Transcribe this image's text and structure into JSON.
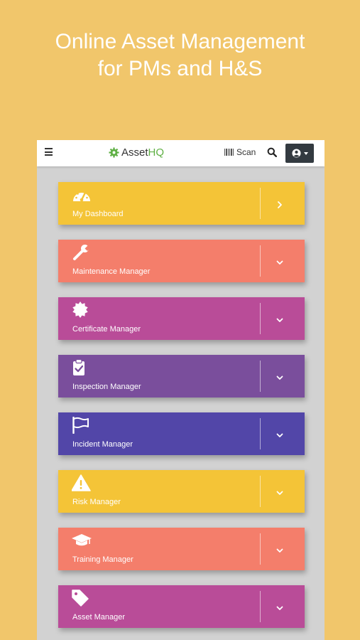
{
  "headline": {
    "line1": "Online Asset Management",
    "line2": "for PMs and H&S"
  },
  "topbar": {
    "logo_prefix": "Asset",
    "logo_suffix": "HQ",
    "scan_label": "Scan"
  },
  "menu": [
    {
      "label": "My Dashboard",
      "icon": "dashboard-gauge-icon",
      "color": "#F4C437",
      "toggle": "chevron-right-icon"
    },
    {
      "label": "Maintenance Manager",
      "icon": "wrench-icon",
      "color": "#F47E6B",
      "toggle": "chevron-down-icon"
    },
    {
      "label": "Certificate Manager",
      "icon": "certificate-seal-icon",
      "color": "#B94C98",
      "toggle": "chevron-down-icon"
    },
    {
      "label": "Inspection Manager",
      "icon": "clipboard-check-icon",
      "color": "#7A4E9C",
      "toggle": "chevron-down-icon"
    },
    {
      "label": "Incident Manager",
      "icon": "flag-icon",
      "color": "#5246A8",
      "toggle": "chevron-down-icon"
    },
    {
      "label": "Risk Manager",
      "icon": "warning-triangle-icon",
      "color": "#F4C437",
      "toggle": "chevron-down-icon"
    },
    {
      "label": "Training Manager",
      "icon": "graduation-cap-icon",
      "color": "#F47E6B",
      "toggle": "chevron-down-icon"
    },
    {
      "label": "Asset Manager",
      "icon": "tag-icon",
      "color": "#B94C98",
      "toggle": "chevron-down-icon"
    }
  ]
}
